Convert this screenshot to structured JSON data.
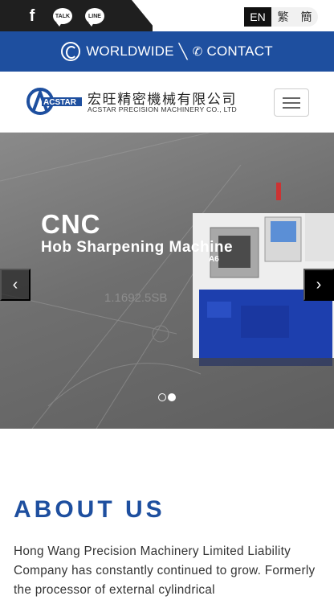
{
  "social": {
    "facebook_icon": "facebook-icon",
    "talk_label": "TALK",
    "line_label": "LINE"
  },
  "languages": [
    "EN",
    "繁",
    "簡"
  ],
  "nav": {
    "worldwide_label": "WORLDWIDE",
    "separator": "╲",
    "contact_label": "CONTACT"
  },
  "logo": {
    "brand": "ACSTAR",
    "chinese_name": "宏旺精密機械有限公司",
    "english_name": "ACSTAR PRECISION MACHINERY CO., LTD"
  },
  "slider": {
    "title": "CNC",
    "subtitle": "Hob Sharpening Machine",
    "prev_arrow": "‹",
    "next_arrow": "›",
    "bg_text": "1.1692.5SB",
    "machine_label": "A6",
    "active_slide": 2,
    "slide_count": 2
  },
  "about": {
    "title": "ABOUT US",
    "text": "Hong Wang Precision Machinery Limited Liability Company has constantly continued to grow. Formerly the processor of external cylindrical"
  },
  "colors": {
    "brand_blue": "#1e4f9f",
    "topbar_dark": "#1f1f1f"
  }
}
